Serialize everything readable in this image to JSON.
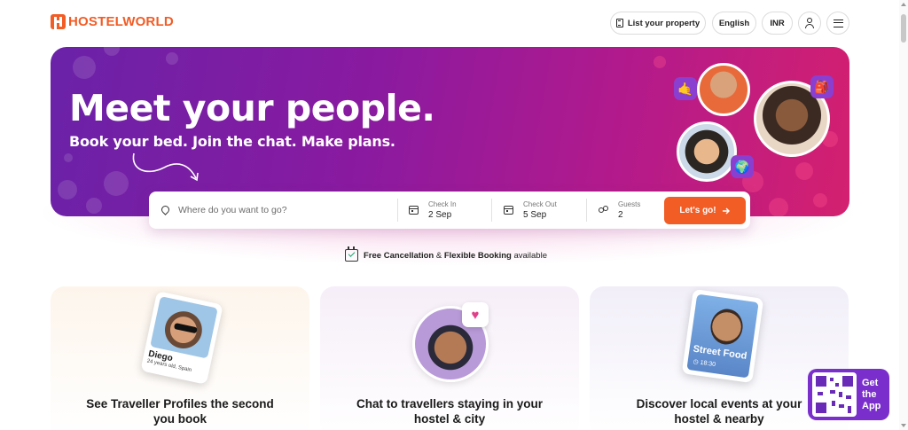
{
  "header": {
    "logo_text": "HOSTELWORLD",
    "list_property": "List your property",
    "language": "English",
    "currency": "INR",
    "icons": [
      "building-icon",
      "user-icon",
      "menu-icon"
    ]
  },
  "hero": {
    "title": "Meet your people.",
    "subtitle": "Book your bed. Join the chat. Make plans."
  },
  "search": {
    "destination_placeholder": "Where do you want to go?",
    "check_in_label": "Check In",
    "check_in_value": "2 Sep",
    "check_out_label": "Check Out",
    "check_out_value": "5 Sep",
    "guests_label": "Guests",
    "guests_value": "2",
    "submit_label": "Let's go!"
  },
  "notice": {
    "part1": "Free Cancellation",
    "part2": " & ",
    "part3": "Flexible Booking",
    "part4": " available"
  },
  "features": [
    {
      "title_line1": "See Traveller Profiles the second",
      "title_line2": "you book",
      "profile_name": "Diego",
      "profile_meta": "24 years old, Spain"
    },
    {
      "title_line1": "Chat to travellers staying in your",
      "title_line2": "hostel & city"
    },
    {
      "title_line1": "Discover local events at your",
      "title_line2": "hostel & nearby",
      "event_name": "Street Food",
      "event_time": "18:30"
    }
  ],
  "app_promo": {
    "line1": "Get",
    "line2": "the",
    "line3": "App"
  },
  "colors": {
    "brand_orange": "#f25c25",
    "hero_purple": "#6a22a8",
    "hero_magenta": "#d4206f",
    "app_purple": "#7a2fcc"
  }
}
